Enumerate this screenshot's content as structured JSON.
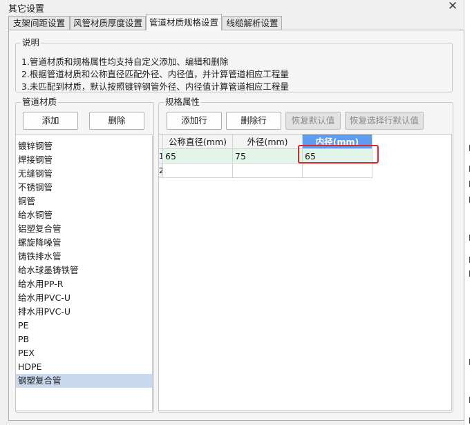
{
  "window": {
    "title": "其它设置",
    "close_label": "✕"
  },
  "tabs": [
    {
      "label": "支架间距设置"
    },
    {
      "label": "风管材质厚度设置"
    },
    {
      "label": "管道材质规格设置",
      "active": true
    },
    {
      "label": "线缆解析设置"
    }
  ],
  "description": {
    "legend": "说明",
    "lines": [
      "1.管道材质和规格属性均支持自定义添加、编辑和删除",
      "2.根据管道材质和公称直径匹配外径、内径值，并计算管道相应工程量",
      "3.未匹配到材质，默认按照镀锌钢管外径、内径值计算管道相应工程量"
    ]
  },
  "material": {
    "legend": "管道材质",
    "add_label": "添加",
    "delete_label": "删除",
    "items": [
      "镀锌钢管",
      "焊接钢管",
      "无缝钢管",
      "不锈钢管",
      "铜管",
      "给水铜管",
      "铝塑复合管",
      "螺旋降噪管",
      "铸铁排水管",
      "给水球墨铸铁管",
      "给水用PP-R",
      "给水用PVC-U",
      "排水用PVC-U",
      "PE",
      "PB",
      "PEX",
      "HDPE",
      "钢塑复合管"
    ],
    "selected_index": 17
  },
  "spec": {
    "legend": "规格属性",
    "add_row_label": "添加行",
    "delete_row_label": "删除行",
    "restore_default_label": "恢复默认值",
    "restore_selected_label": "恢复选择行默认值",
    "columns": [
      "公称直径(mm)",
      "外径(mm)",
      "内径(mm)"
    ],
    "rows": [
      {
        "num": "1",
        "cells": [
          "65",
          "75",
          "65"
        ]
      },
      {
        "num": "2",
        "cells": [
          "",
          "",
          ""
        ]
      }
    ]
  }
}
